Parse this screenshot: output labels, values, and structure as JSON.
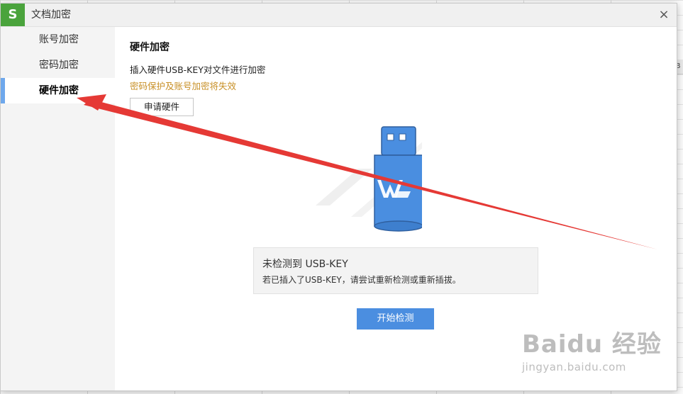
{
  "window": {
    "title": "文档加密",
    "app_logo": "S",
    "close_icon": "×"
  },
  "sidebar": {
    "items": [
      {
        "label": "账号加密",
        "active": false
      },
      {
        "label": "密码加密",
        "active": false
      },
      {
        "label": "硬件加密",
        "active": true
      }
    ]
  },
  "main": {
    "section_title": "硬件加密",
    "description": "插入硬件USB-KEY对文件进行加密",
    "warning": "密码保护及账号加密将失效",
    "apply_button": "申请硬件",
    "status": {
      "title": "未检测到 USB-KEY",
      "detail": "若已插入了USB-KEY，请尝试重新检测或重新插拔。"
    },
    "start_button": "开始检测"
  },
  "background": {
    "column_header": "B"
  },
  "watermark": {
    "logo": "Baidu 经验",
    "url": "jingyan.baidu.com"
  },
  "colors": {
    "accent_blue": "#4b8ee0",
    "active_bar": "#6ea8ec",
    "warning": "#c89027",
    "app_logo_green": "#4aa33c",
    "usb_blue": "#4a8ee0",
    "annotation_red": "#e53935"
  },
  "icons": [
    "wps-logo-icon",
    "close-icon",
    "usb-key-icon",
    "red-arrow-annotation"
  ]
}
